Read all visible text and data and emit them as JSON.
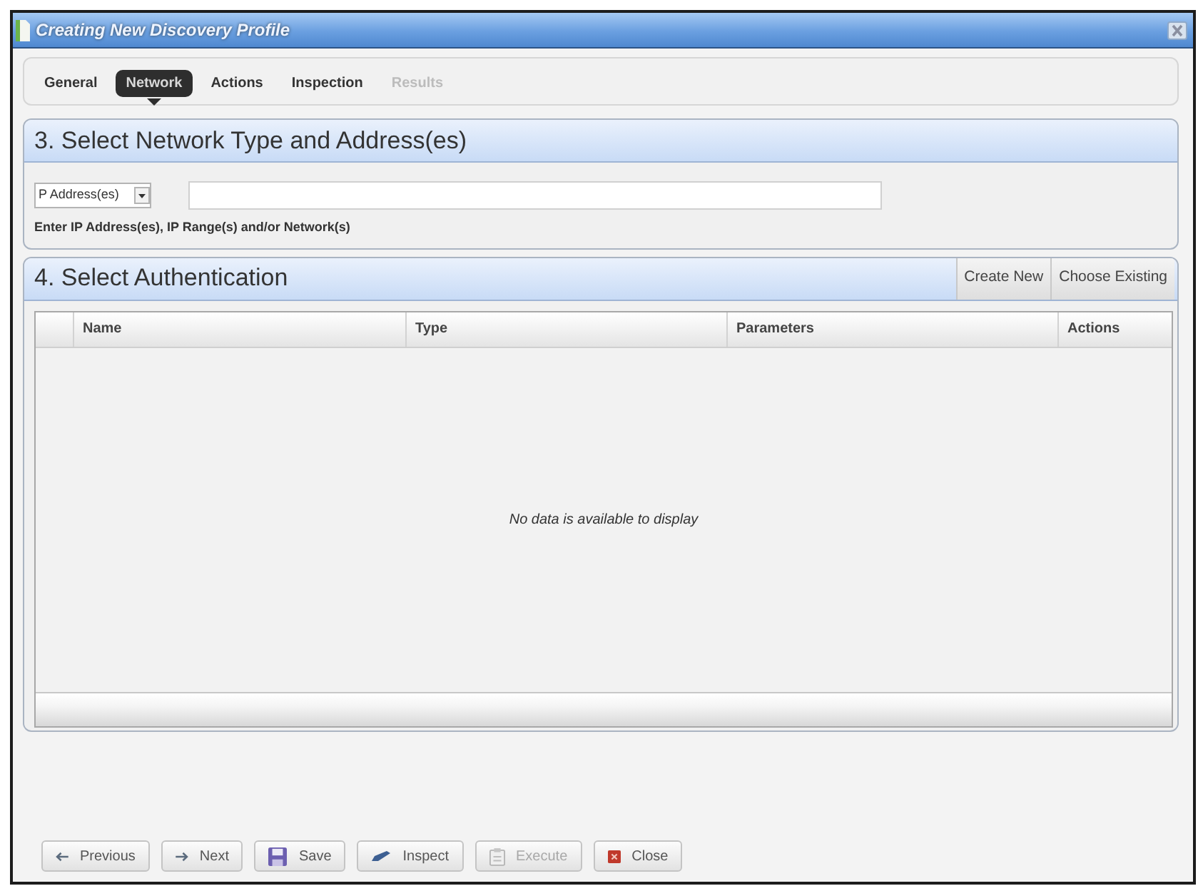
{
  "window": {
    "title": "Creating New Discovery Profile"
  },
  "tabs": [
    {
      "label": "General",
      "selected": false,
      "disabled": false
    },
    {
      "label": "Network",
      "selected": true,
      "disabled": false
    },
    {
      "label": "Actions",
      "selected": false,
      "disabled": false
    },
    {
      "label": "Inspection",
      "selected": false,
      "disabled": false
    },
    {
      "label": "Results",
      "selected": false,
      "disabled": true
    }
  ],
  "network_section": {
    "title": "3. Select Network Type and Address(es)",
    "type_select": {
      "value": "P Address(es)"
    },
    "hint": "Enter IP Address(es), IP Range(s) and/or Network(s)"
  },
  "authentication_section": {
    "title": "4. Select Authentication",
    "buttons": [
      "Create New",
      "Choose Existing"
    ],
    "table": {
      "columns": [
        "Name",
        "Type",
        "Parameters",
        "Actions"
      ],
      "empty_message": "No data is available to display"
    }
  },
  "footer_buttons": [
    {
      "label": "Previous",
      "kind": "previous",
      "disabled": false
    },
    {
      "label": "Next",
      "kind": "next",
      "disabled": false
    },
    {
      "label": "Save",
      "kind": "save",
      "disabled": false
    },
    {
      "label": "Inspect",
      "kind": "inspect",
      "disabled": false
    },
    {
      "label": "Execute",
      "kind": "execute",
      "disabled": true
    },
    {
      "label": "Close",
      "kind": "close",
      "disabled": false
    }
  ]
}
